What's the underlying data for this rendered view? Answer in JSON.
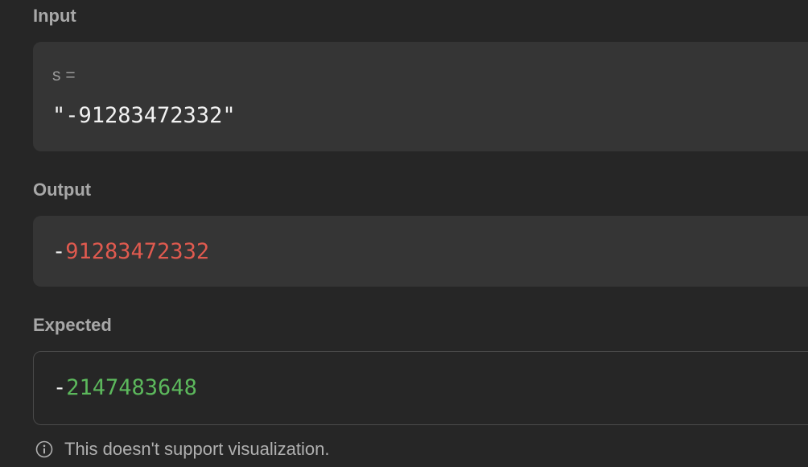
{
  "input": {
    "section_label": "Input",
    "var_name": "s =",
    "value": "\"-91283472332\""
  },
  "output": {
    "section_label": "Output",
    "sign": "-",
    "digits": "91283472332",
    "digits_color": "#e05a4f"
  },
  "expected": {
    "section_label": "Expected",
    "sign": "-",
    "digits": "2147483648",
    "digits_color": "#5cb85c"
  },
  "footer": {
    "icon": "info-icon",
    "note": "This doesn't support visualization."
  }
}
